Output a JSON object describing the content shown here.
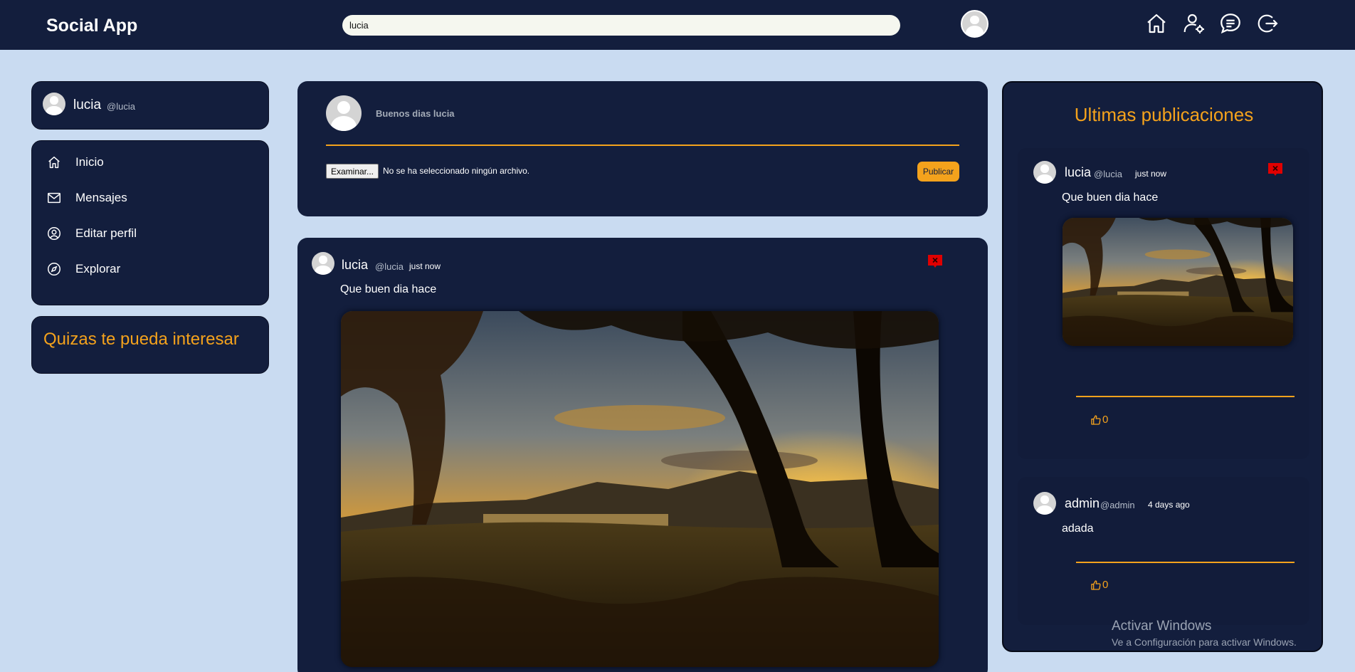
{
  "header": {
    "brand": "Social App",
    "search_value": "lucia",
    "nav_icons": [
      "home-icon",
      "user-settings-icon",
      "chat-icon",
      "logout-icon"
    ]
  },
  "sidebar": {
    "profile": {
      "name": "lucia",
      "handle": "@lucia"
    },
    "menu": [
      {
        "label": "Inicio",
        "icon": "home-icon"
      },
      {
        "label": "Mensajes",
        "icon": "mail-icon"
      },
      {
        "label": "Editar perfil",
        "icon": "user-circle-icon"
      },
      {
        "label": "Explorar",
        "icon": "compass-icon"
      }
    ],
    "suggestions_title": "Quizas te pueda interesar"
  },
  "composer": {
    "greeting": "Buenos dias lucia",
    "file_button": "Examinar...",
    "file_status": "No se ha seleccionado ningún archivo.",
    "publish_label": "Publicar"
  },
  "feed": {
    "post": {
      "name": "lucia",
      "handle": "@lucia",
      "time": "just now",
      "text": "Que buen dia hace"
    }
  },
  "latest": {
    "title": "Ultimas publicaciones",
    "posts": [
      {
        "name": "lucia",
        "handle": "@lucia",
        "time": "just now",
        "text": "Que buen dia hace",
        "likes": "0"
      },
      {
        "name": "admin",
        "handle": "@admin",
        "time": "4 days ago",
        "text": "adada",
        "likes": "0"
      }
    ]
  },
  "watermark": {
    "title": "Activar Windows",
    "subtitle": "Ve a Configuración para activar Windows."
  },
  "colors": {
    "accent": "#f4a21c",
    "navy": "#131e3d",
    "page_bg": "#c9dbf1",
    "delete": "#e00000"
  }
}
